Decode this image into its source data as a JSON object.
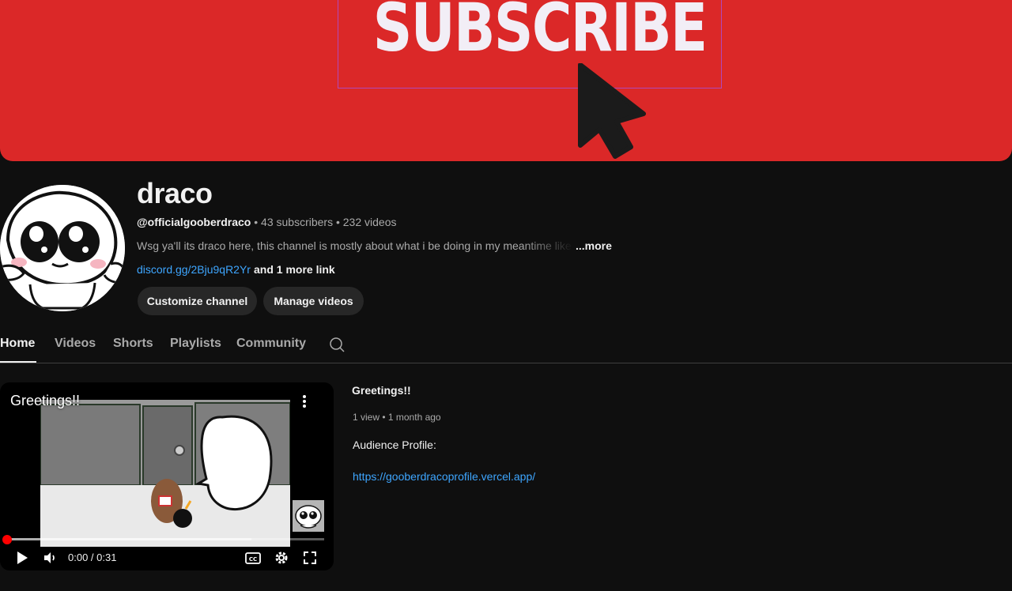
{
  "banner": {
    "text": "SUBSCRIBE",
    "bg_color": "#db2828"
  },
  "channel": {
    "name": "draco",
    "handle": "@officialgooberdraco",
    "subscribers": "43 subscribers",
    "videos": "232 videos",
    "separator": "•",
    "description": "Wsg ya'll its draco here, this channel is mostly about what i be doing in my meantime like",
    "more_label": "...more",
    "link": "discord.gg/2Bju9qR2Yr",
    "more_links": "and 1 more link",
    "customize_label": "Customize channel",
    "manage_label": "Manage videos"
  },
  "tabs": [
    {
      "label": "Home",
      "active": true
    },
    {
      "label": "Videos",
      "active": false
    },
    {
      "label": "Shorts",
      "active": false
    },
    {
      "label": "Playlists",
      "active": false
    },
    {
      "label": "Community",
      "active": false
    }
  ],
  "player": {
    "title": "Greetings!!",
    "time": "0:00 / 0:31",
    "progress": 0.0,
    "buffered": 0.77
  },
  "video_info": {
    "title": "Greetings!!",
    "meta": "1 view • 1 month ago",
    "audience_label": "Audience Profile:",
    "url": "https://gooberdracoprofile.vercel.app/"
  },
  "icons": {
    "tab_search": "search-icon",
    "player_menu": "more-vert-icon",
    "play": "play-icon",
    "volume": "volume-icon",
    "captions": "cc-icon",
    "settings": "gear-icon",
    "fullscreen": "fullscreen-icon"
  },
  "colors": {
    "accent_link": "#3ea6ff",
    "progress_red": "#ff0000",
    "page_bg": "#0f0f0f"
  }
}
